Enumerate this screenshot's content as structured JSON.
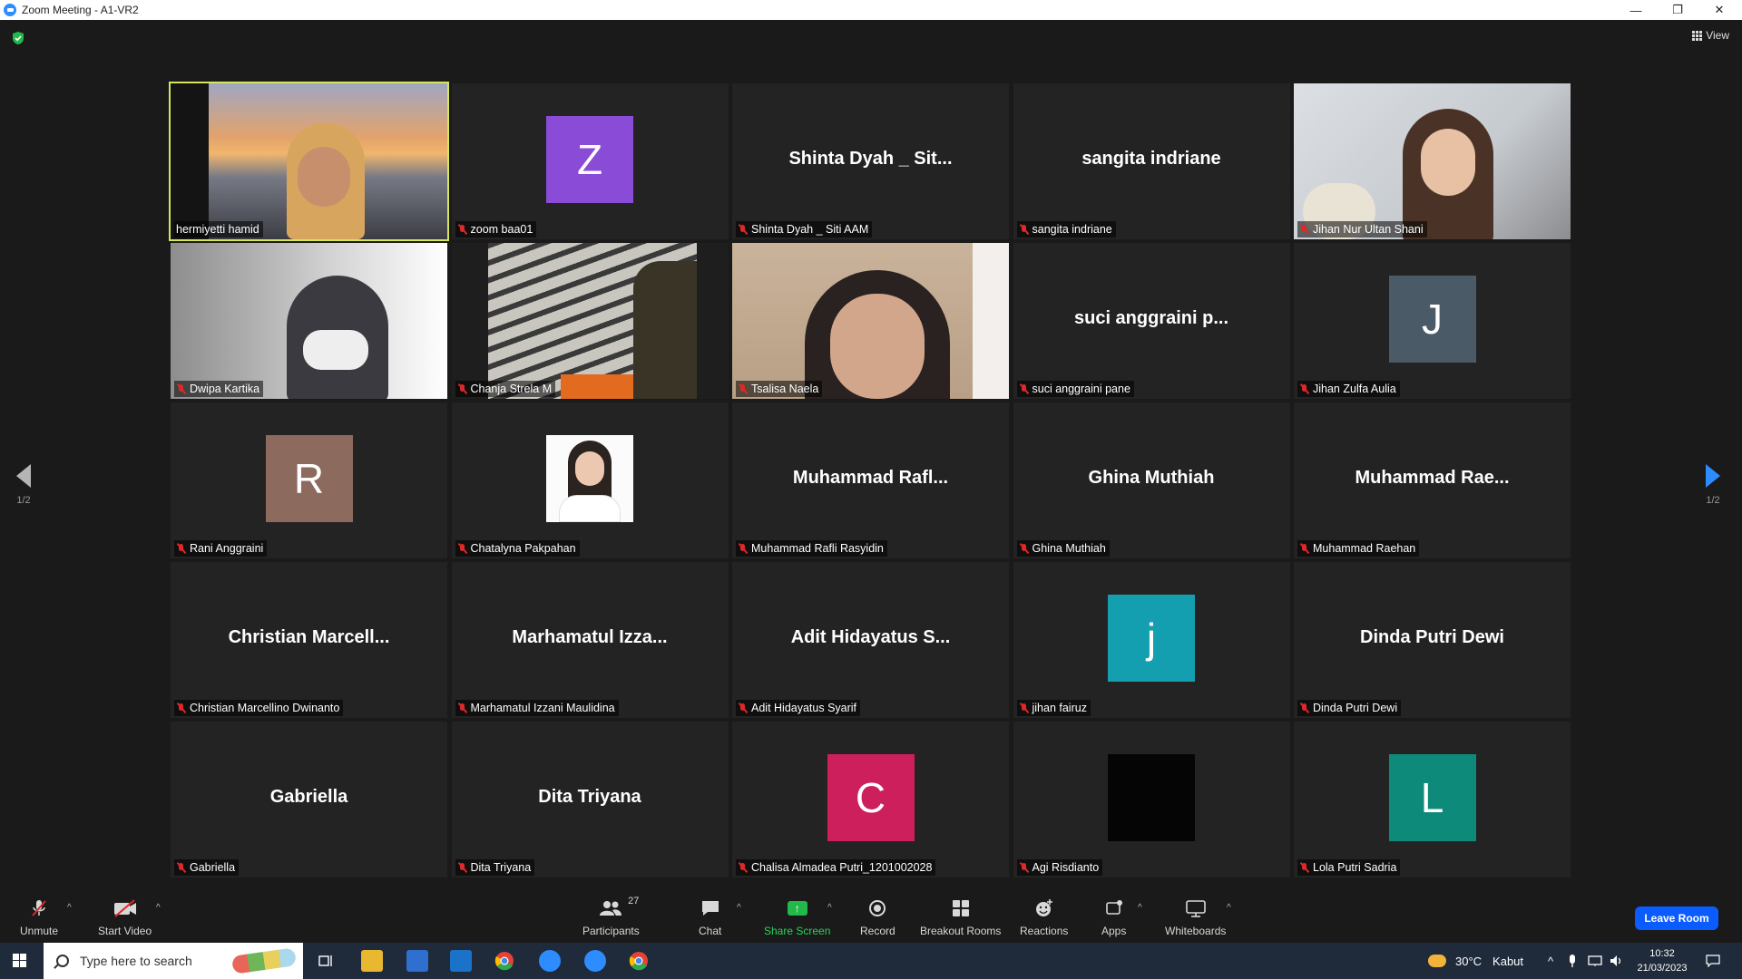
{
  "window": {
    "title": "Zoom Meeting - A1-VR2",
    "minimize": "—",
    "restore": "❐",
    "close": "✕"
  },
  "header": {
    "view_label": "View"
  },
  "pagination": {
    "left": "1/2",
    "right": "1/2"
  },
  "tiles": [
    {
      "label": "hermiyetti hamid",
      "muted": false,
      "kind": "video",
      "active": true
    },
    {
      "label": "zoom baa01",
      "muted": true,
      "kind": "avatar",
      "initial": "Z",
      "color": "#8a4bd6"
    },
    {
      "label": "Shinta Dyah _ Siti AAM",
      "muted": true,
      "kind": "name",
      "display": "Shinta Dyah _ Sit..."
    },
    {
      "label": "sangita indriane",
      "muted": true,
      "kind": "name",
      "display": "sangita indriane"
    },
    {
      "label": "Jihan Nur Ultan Shani",
      "muted": true,
      "kind": "video"
    },
    {
      "label": "Dwipa Kartika",
      "muted": true,
      "kind": "video"
    },
    {
      "label": "Chanja Strela M",
      "muted": true,
      "kind": "video"
    },
    {
      "label": "Tsalisa Naela",
      "muted": true,
      "kind": "video"
    },
    {
      "label": "suci anggraini pane",
      "muted": true,
      "kind": "name",
      "display": "suci anggraini p..."
    },
    {
      "label": "Jihan Zulfa Aulia",
      "muted": true,
      "kind": "avatar",
      "initial": "J",
      "color": "#4a5a66"
    },
    {
      "label": "Rani Anggraini",
      "muted": true,
      "kind": "avatar",
      "initial": "R",
      "color": "#8c6a5d"
    },
    {
      "label": "Chatalyna Pakpahan",
      "muted": true,
      "kind": "photo"
    },
    {
      "label": "Muhammad Rafli Rasyidin",
      "muted": true,
      "kind": "name",
      "display": "Muhammad  Rafl..."
    },
    {
      "label": "Ghina Muthiah",
      "muted": true,
      "kind": "name",
      "display": "Ghina Muthiah"
    },
    {
      "label": "Muhammad Raehan",
      "muted": true,
      "kind": "name",
      "display": "Muhammad  Rae..."
    },
    {
      "label": "Christian Marcellino Dwinanto",
      "muted": true,
      "kind": "name",
      "display": "Christian  Marcell..."
    },
    {
      "label": "Marhamatul Izzani Maulidina",
      "muted": true,
      "kind": "name",
      "display": "Marhamatul  Izza..."
    },
    {
      "label": "Adit Hidayatus Syarif",
      "muted": true,
      "kind": "name",
      "display": "Adit Hidayatus S..."
    },
    {
      "label": "jihan fairuz",
      "muted": true,
      "kind": "avatar",
      "initial": "j",
      "color": "#139fb0"
    },
    {
      "label": "Dinda Putri Dewi",
      "muted": true,
      "kind": "name",
      "display": "Dinda Putri Dewi"
    },
    {
      "label": "Gabriella",
      "muted": true,
      "kind": "name",
      "display": "Gabriella"
    },
    {
      "label": "Dita Triyana",
      "muted": true,
      "kind": "name",
      "display": "Dita Triyana"
    },
    {
      "label": "Chalisa Almadea Putri_1201002028",
      "muted": true,
      "kind": "avatar",
      "initial": "C",
      "color": "#cc1f5c"
    },
    {
      "label": "Agi Risdianto",
      "muted": true,
      "kind": "avatar",
      "initial": "",
      "color": "#050505"
    },
    {
      "label": "Lola Putri Sadria",
      "muted": true,
      "kind": "avatar",
      "initial": "L",
      "color": "#0d8a7a"
    }
  ],
  "toolbar": {
    "unmute": "Unmute",
    "start_video": "Start Video",
    "participants": "Participants",
    "participants_count": "27",
    "chat": "Chat",
    "share_screen": "Share Screen",
    "record": "Record",
    "breakout_rooms": "Breakout Rooms",
    "reactions": "Reactions",
    "apps": "Apps",
    "whiteboards": "Whiteboards",
    "leave_room": "Leave Room"
  },
  "taskbar": {
    "search_placeholder": "Type here to search",
    "weather_temp": "30°C",
    "weather_desc": "Kabut",
    "time": "10:32",
    "date": "21/03/2023"
  },
  "colors": {
    "accent_blue": "#0b5cff",
    "share_green": "#23b84a",
    "active_speaker": "#d6e55a",
    "mute_red": "#e02828"
  }
}
